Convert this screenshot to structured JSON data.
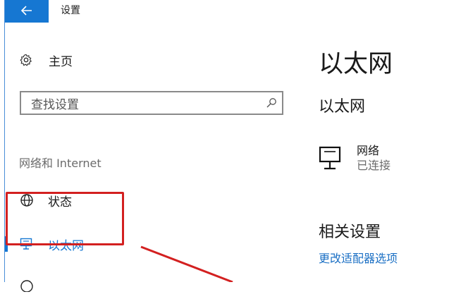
{
  "window": {
    "title": "设置",
    "accent_color": "#1677d2"
  },
  "header": {
    "back_icon": "arrow-left-icon"
  },
  "sidebar": {
    "home_label": "主页",
    "home_icon": "gear-icon",
    "search": {
      "placeholder": "查找设置",
      "icon": "search-icon"
    },
    "section_title": "网络和 Internet",
    "items": [
      {
        "label": "状态",
        "icon": "globe-icon",
        "selected": false
      },
      {
        "label": "以太网",
        "icon": "monitor-icon",
        "selected": true
      },
      {
        "label": "",
        "icon": "dialup-icon",
        "selected": false
      }
    ]
  },
  "main": {
    "page_title": "以太网",
    "sub_title": "以太网",
    "network": {
      "name": "网络",
      "status": "已连接",
      "icon": "monitor-icon"
    },
    "related": {
      "title": "相关设置",
      "link": "更改适配器选项",
      "link_color": "#1a6fc4"
    }
  },
  "annotation": {
    "highlight_color": "#d32020"
  }
}
